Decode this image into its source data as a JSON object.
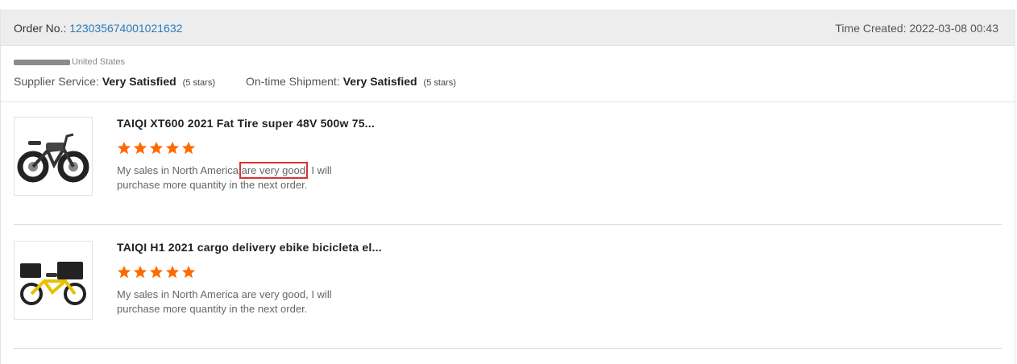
{
  "order": {
    "label": "Order No.:",
    "number": "123035674001021632",
    "time": "Time Created: 2022-03-08 00:43"
  },
  "buyer": {
    "country": "United States"
  },
  "ratings": {
    "supplier_label": "Supplier Service:",
    "supplier_value": "Very Satisfied",
    "supplier_stars": "(5 stars)",
    "shipment_label": "On-time Shipment:",
    "shipment_value": "Very Satisfied",
    "shipment_stars": "(5 stars)"
  },
  "reviews": [
    {
      "title": "TAIQI XT600 2021 Fat Tire super 48V 500w 75...",
      "rating": 5,
      "comment_before": "My sales in North America ",
      "comment_highlight": "are very good",
      "comment_after": ", I will purchase more quantity in the next order."
    },
    {
      "title": "TAIQI H1 2021 cargo delivery ebike bicicleta el...",
      "rating": 5,
      "comment": "My sales in North America are very good, I will purchase more quantity in the next order."
    }
  ],
  "colors": {
    "star": "#ff6a00",
    "link": "#2a7ab8",
    "highlight": "#e03131"
  }
}
